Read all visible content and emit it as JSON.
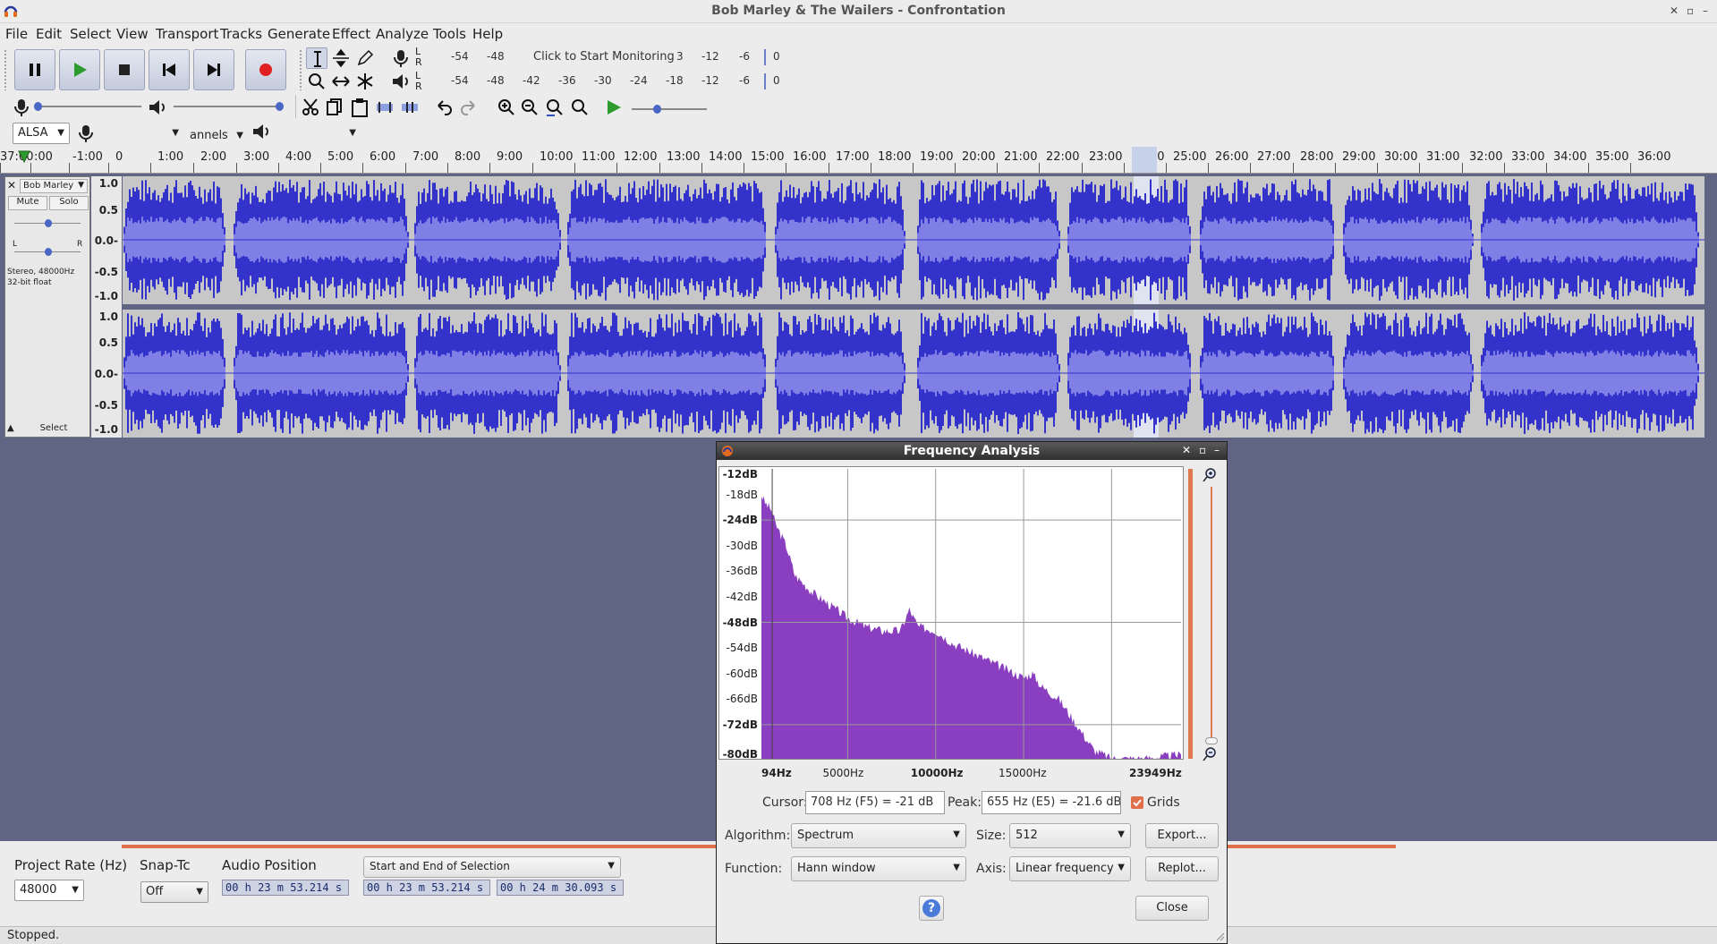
{
  "window": {
    "title": "Bob Marley & The Wailers - Confrontation"
  },
  "menu": [
    "File",
    "Edit",
    "Select",
    "View",
    "Transport",
    "Tracks",
    "Generate",
    "Effect",
    "Analyze",
    "Tools",
    "Help"
  ],
  "meters": {
    "rec_scale": [
      "-54",
      "-48",
      "-12",
      "-6",
      "0"
    ],
    "rec_prompt": "Click to Start Monitoring",
    "rec_trail": "3",
    "play_scale": [
      "-54",
      "-48",
      "-42",
      "-36",
      "-30",
      "-24",
      "-18",
      "-12",
      "-6",
      "0"
    ],
    "channel_left": "L",
    "channel_right": "R"
  },
  "device": {
    "host": "ALSA",
    "channels": "annels"
  },
  "ruler": {
    "ticks": [
      ":00",
      "-1:00",
      "0",
      "1:00",
      "2:00",
      "3:00",
      "4:00",
      "5:00",
      "6:00",
      "7:00",
      "8:00",
      "9:00",
      "10:00",
      "11:00",
      "12:00",
      "13:00",
      "14:00",
      "15:00",
      "16:00",
      "17:00",
      "18:00",
      "19:00",
      "20:00",
      "21:00",
      "22:00",
      "23:00",
      "24:00",
      "25:00",
      "26:00",
      "27:00",
      "28:00",
      "29:00",
      "30:00",
      "31:00",
      "32:00",
      "33:00",
      "34:00",
      "35:00",
      "36:00",
      "37:00"
    ]
  },
  "track": {
    "name": "Bob Marley",
    "mute": "Mute",
    "solo": "Solo",
    "pan_left": "L",
    "pan_right": "R",
    "info_line1": "Stereo, 48000Hz",
    "info_line2": "32-bit float",
    "select": "Select",
    "vruler": [
      "1.0",
      "0.5",
      "0.0-",
      "-0.5",
      "-1.0"
    ]
  },
  "freq": {
    "title": "Frequency Analysis",
    "db_labels": [
      "-12dB",
      "-18dB",
      "-24dB",
      "-30dB",
      "-36dB",
      "-42dB",
      "-48dB",
      "-54dB",
      "-60dB",
      "-66dB",
      "-72dB",
      "-80dB"
    ],
    "hz_labels": [
      "94Hz",
      "5000Hz",
      "10000Hz",
      "15000Hz",
      "23949Hz"
    ],
    "cursor_label": "Cursor:",
    "cursor_value": "708 Hz (F5) = -21 dB",
    "peak_label": "Peak:",
    "peak_value": "655 Hz (E5) = -21.6 dB",
    "grids_label": "Grids",
    "grids_checked": true,
    "algorithm_label": "Algorithm:",
    "algorithm_value": "Spectrum",
    "size_label": "Size:",
    "size_value": "512",
    "function_label": "Function:",
    "function_value": "Hann window",
    "axis_label": "Axis:",
    "axis_value": "Linear frequency",
    "export_label": "Export...",
    "replot_label": "Replot...",
    "help_label": "?",
    "close_label": "Close",
    "spectrum_color": "#8a3fc0"
  },
  "bottom": {
    "project_rate_label": "Project Rate (Hz)",
    "project_rate_value": "48000",
    "snap_label": "Snap-Tc",
    "snap_value": "Off",
    "audio_position_label": "Audio Position",
    "audio_position_value": "00 h 23 m 53.214 s",
    "selection_mode": "Start and End of Selection",
    "sel_start": "00 h 23 m 53.214 s",
    "sel_end": "00 h 24 m 30.093 s",
    "status": "Stopped."
  },
  "colors": {
    "waveform": "#3333cc",
    "waveform_rms": "#7f7fe6",
    "accent": "#e0704a"
  }
}
